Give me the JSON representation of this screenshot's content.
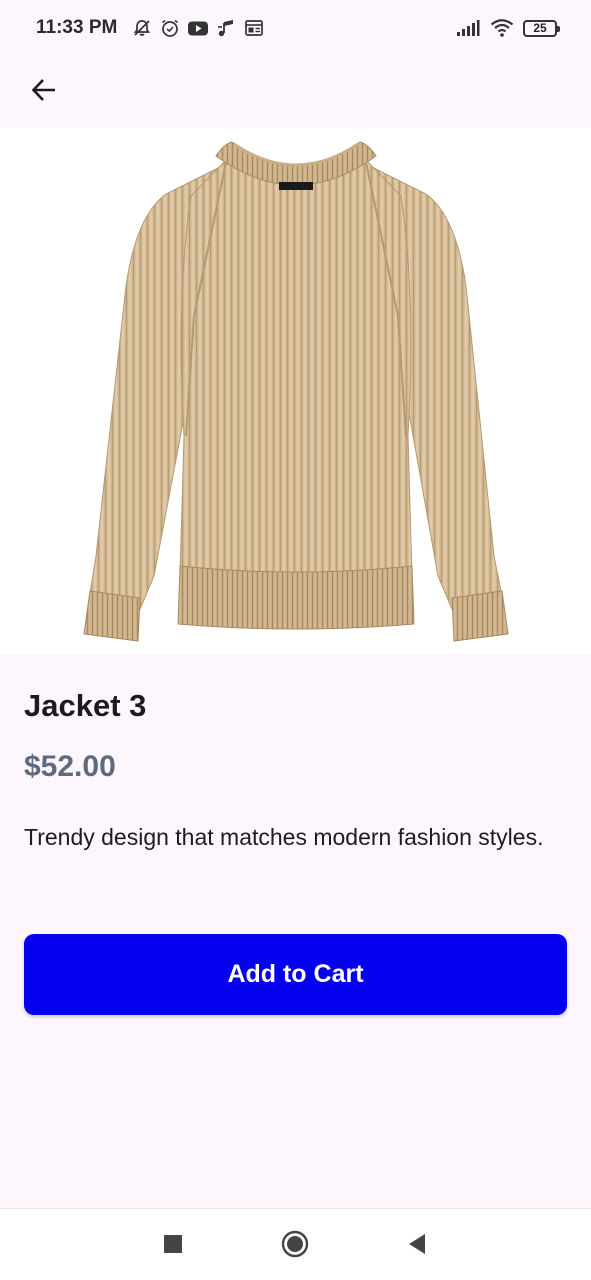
{
  "status_bar": {
    "time": "11:33 PM",
    "battery_level": "25",
    "left_icons": [
      "notifications-off-icon",
      "alarm-icon",
      "youtube-icon",
      "music-icon",
      "news-icon"
    ],
    "right_icons": [
      "signal-icon",
      "wifi-icon",
      "battery-icon"
    ]
  },
  "app_bar": {
    "back_icon": "arrow-back-icon"
  },
  "product": {
    "image_icon": "sweater-image",
    "title": "Jacket 3",
    "price": "$52.00",
    "description": "Trendy design that matches modern fashion styles."
  },
  "actions": {
    "add_to_cart_label": "Add to Cart",
    "button_color": "#0500ee"
  },
  "nav_bar": {
    "icons": [
      "recents-icon",
      "home-icon",
      "back-nav-icon"
    ]
  },
  "colors": {
    "background": "#fdf6fc",
    "price_color": "#5d6b7f",
    "accent": "#0500ee"
  }
}
